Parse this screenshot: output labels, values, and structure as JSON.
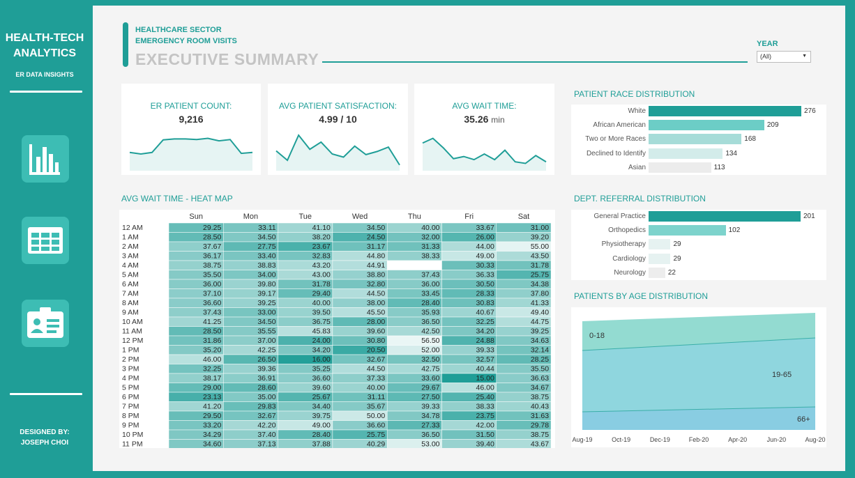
{
  "sidebar": {
    "brand_line1": "HEALTH-TECH",
    "brand_line2": "ANALYTICS",
    "subtitle": "ER DATA INSIGHTS",
    "icons": [
      "bar-chart-icon",
      "table-icon",
      "id-card-icon"
    ],
    "designer_label": "DESIGNED BY:",
    "designer_name": "JOSEPH CHOI"
  },
  "header": {
    "line1": "HEALTHCARE SECTOR",
    "line2": "EMERGENCY ROOM VISITS",
    "title": "EXECUTIVE SUMMARY"
  },
  "filter": {
    "label": "YEAR",
    "value": "(All)"
  },
  "kpis": [
    {
      "label": "ER PATIENT COUNT:",
      "value": "9,216",
      "unit": "",
      "trend": [
        0.45,
        0.4,
        0.45,
        0.85,
        0.88,
        0.88,
        0.86,
        0.9,
        0.82,
        0.86,
        0.42,
        0.45
      ]
    },
    {
      "label": "AVG PATIENT SATISFACTION:",
      "value": "4.99 / 10",
      "unit": "",
      "trend": [
        0.5,
        0.2,
        1.0,
        0.55,
        0.78,
        0.4,
        0.3,
        0.65,
        0.38,
        0.48,
        0.62,
        0.05
      ]
    },
    {
      "label": "AVG WAIT TIME:",
      "value": "35.26",
      "unit": "min",
      "trend": [
        0.75,
        0.9,
        0.6,
        0.25,
        0.32,
        0.22,
        0.4,
        0.22,
        0.52,
        0.15,
        0.1,
        0.35,
        0.15
      ]
    }
  ],
  "heatmap": {
    "title": "AVG WAIT TIME - HEAT MAP",
    "days": [
      "Sun",
      "Mon",
      "Tue",
      "Wed",
      "Thu",
      "Fri",
      "Sat"
    ],
    "hours": [
      "12 AM",
      "1 AM",
      "2 AM",
      "3 AM",
      "4 AM",
      "5 AM",
      "6 AM",
      "7 AM",
      "8 AM",
      "9 AM",
      "10 AM",
      "11 AM",
      "12 PM",
      "1 PM",
      "2 PM",
      "3 PM",
      "4 PM",
      "5 PM",
      "6 PM",
      "7 PM",
      "8 PM",
      "9 PM",
      "10 PM",
      "11 PM"
    ],
    "values": [
      [
        "29.25",
        "33.11",
        "41.10",
        "34.50",
        "40.00",
        "33.67",
        "31.00"
      ],
      [
        "28.50",
        "34.50",
        "38.20",
        "24.50",
        "32.00",
        "26.00",
        "39.20"
      ],
      [
        "37.67",
        "27.75",
        "23.67",
        "31.17",
        "31.33",
        "44.00",
        "55.00"
      ],
      [
        "36.17",
        "33.40",
        "32.83",
        "44.80",
        "38.33",
        "49.00",
        "43.50"
      ],
      [
        "38.75",
        "38.83",
        "43.20",
        "44.91",
        "",
        "30.33",
        "31.78"
      ],
      [
        "35.50",
        "34.00",
        "43.00",
        "38.80",
        "37.43",
        "36.33",
        "25.75"
      ],
      [
        "36.00",
        "39.80",
        "31.78",
        "32.80",
        "36.00",
        "30.50",
        "34.38"
      ],
      [
        "37.10",
        "39.17",
        "29.40",
        "44.50",
        "33.45",
        "28.33",
        "37.80"
      ],
      [
        "36.60",
        "39.25",
        "40.00",
        "38.00",
        "28.40",
        "30.83",
        "41.33"
      ],
      [
        "37.43",
        "33.00",
        "39.50",
        "45.50",
        "35.93",
        "40.67",
        "49.40"
      ],
      [
        "41.25",
        "34.50",
        "36.75",
        "28.00",
        "36.50",
        "32.25",
        "44.75"
      ],
      [
        "28.50",
        "35.55",
        "45.83",
        "39.60",
        "42.50",
        "34.20",
        "39.25"
      ],
      [
        "31.86",
        "37.00",
        "24.00",
        "30.80",
        "56.50",
        "24.88",
        "34.63"
      ],
      [
        "35.20",
        "42.25",
        "34.20",
        "20.50",
        "52.00",
        "39.33",
        "32.14"
      ],
      [
        "46.00",
        "26.50",
        "16.00",
        "32.67",
        "32.50",
        "32.57",
        "28.25"
      ],
      [
        "32.25",
        "39.36",
        "35.25",
        "44.50",
        "42.75",
        "40.44",
        "35.50"
      ],
      [
        "38.17",
        "36.91",
        "36.60",
        "37.33",
        "33.60",
        "15.00",
        "36.63"
      ],
      [
        "29.00",
        "28.60",
        "39.60",
        "40.00",
        "29.67",
        "46.00",
        "34.67"
      ],
      [
        "23.13",
        "35.00",
        "25.67",
        "31.11",
        "27.50",
        "25.40",
        "38.75"
      ],
      [
        "41.20",
        "29.83",
        "34.40",
        "35.67",
        "39.33",
        "38.33",
        "40.43"
      ],
      [
        "29.50",
        "32.67",
        "39.75",
        "50.00",
        "34.78",
        "23.75",
        "31.63"
      ],
      [
        "33.20",
        "42.20",
        "49.00",
        "36.60",
        "27.33",
        "42.00",
        "29.78"
      ],
      [
        "34.29",
        "37.40",
        "28.40",
        "25.75",
        "36.50",
        "31.50",
        "38.75"
      ],
      [
        "34.60",
        "37.13",
        "37.88",
        "40.29",
        "53.00",
        "39.40",
        "43.67"
      ]
    ]
  },
  "race": {
    "title": "PATIENT RACE DISTRIBUTION",
    "items": [
      {
        "label": "White",
        "value": 276,
        "color": "#1f9e97"
      },
      {
        "label": "African American",
        "value": 209,
        "color": "#6ccdc6"
      },
      {
        "label": "Two or More Races",
        "value": 168,
        "color": "#a6dcd8"
      },
      {
        "label": "Declined to Identify",
        "value": 134,
        "color": "#d3ecea"
      },
      {
        "label": "Asian",
        "value": 113,
        "color": "#ececec"
      }
    ]
  },
  "referral": {
    "title": "DEPT. REFERRAL DISTRIBUTION",
    "items": [
      {
        "label": "General Practice",
        "value": 201,
        "color": "#1f9e97"
      },
      {
        "label": "Orthopedics",
        "value": 102,
        "color": "#7dd3cc"
      },
      {
        "label": "Physiotherapy",
        "value": 29,
        "color": "#e6f2f1"
      },
      {
        "label": "Cardiology",
        "value": 29,
        "color": "#e6f2f1"
      },
      {
        "label": "Neurology",
        "value": 22,
        "color": "#ededed"
      }
    ]
  },
  "age": {
    "title": "PATIENTS BY AGE DISTRIBUTION",
    "xlabels": [
      "Aug-19",
      "Oct-19",
      "Dec-19",
      "Feb-20",
      "Apr-20",
      "Jun-20",
      "Aug-20"
    ],
    "bands": [
      {
        "label": "0-18",
        "color": "#93dbd1"
      },
      {
        "label": "19-65",
        "color": "#8fd6de"
      },
      {
        "label": "66+",
        "color": "#89cde2"
      }
    ]
  }
}
